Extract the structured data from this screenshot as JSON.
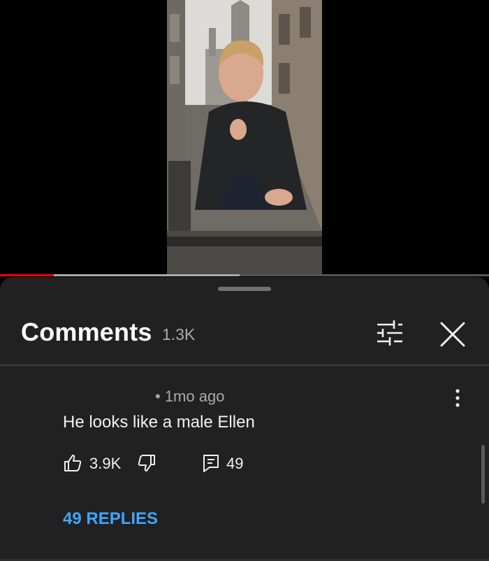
{
  "player": {
    "progress_played": 0.11,
    "progress_buffered": 0.49,
    "accent_color": "#ff0000"
  },
  "comments_panel": {
    "title": "Comments",
    "count": "1.3K",
    "filter_icon": "sliders-icon",
    "close_icon": "close-icon"
  },
  "comment": {
    "meta": "• 1mo ago",
    "text": "He looks like a male Ellen",
    "likes": "3.9K",
    "reply_count": "49",
    "replies_label": "49 REPLIES",
    "link_color": "#3ea6ff",
    "icons": [
      "thumbs-up-icon",
      "thumbs-down-icon",
      "comment-icon",
      "more-vertical-icon"
    ]
  }
}
